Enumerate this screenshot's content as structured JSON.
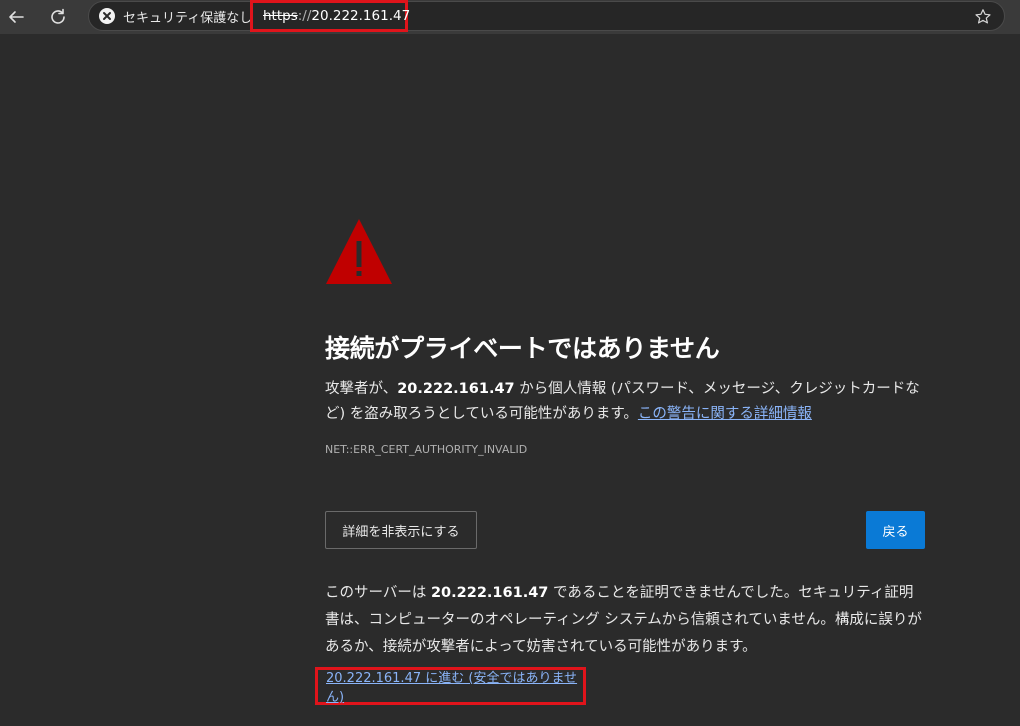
{
  "toolbar": {
    "back_icon": "arrow-left-icon",
    "reload_icon": "reload-icon",
    "security_chip_label": "セキュリティ保護なし",
    "url_scheme": "https",
    "url_separator": "://",
    "url_host": "20.222.161.47",
    "bookmark_icon": "star-icon"
  },
  "interstitial": {
    "warning_icon": "warning-triangle-icon",
    "title": "接続がプライベートではありません",
    "desc_part1": "攻撃者が、",
    "desc_host": "20.222.161.47",
    "desc_part2": " から個人情報 (パスワード、メッセージ、クレジットカードなど) を盗み取ろうとしている可能性があります。",
    "learn_more_link": "この警告に関する詳細情報",
    "error_code": "NET::ERR_CERT_AUTHORITY_INVALID",
    "hide_details_button": "詳細を非表示にする",
    "back_button": "戻る",
    "detail_part1": "このサーバーは ",
    "detail_host": "20.222.161.47",
    "detail_part2": " であることを証明できませんでした。セキュリティ証明書は、コンピューターのオペレーティング システムから信頼されていません。構成に誤りがあるか、接続が攻撃者によって妨害されている可能性があります。",
    "proceed_link": "20.222.161.47 に進む (安全ではありません)"
  },
  "colors": {
    "background": "#2b2b2b",
    "toolbar": "#3a3a3a",
    "accent_button": "#0a7ad6",
    "link": "#8ab4f8",
    "warning_red": "#c00000",
    "highlight_box": "#e0141b"
  }
}
